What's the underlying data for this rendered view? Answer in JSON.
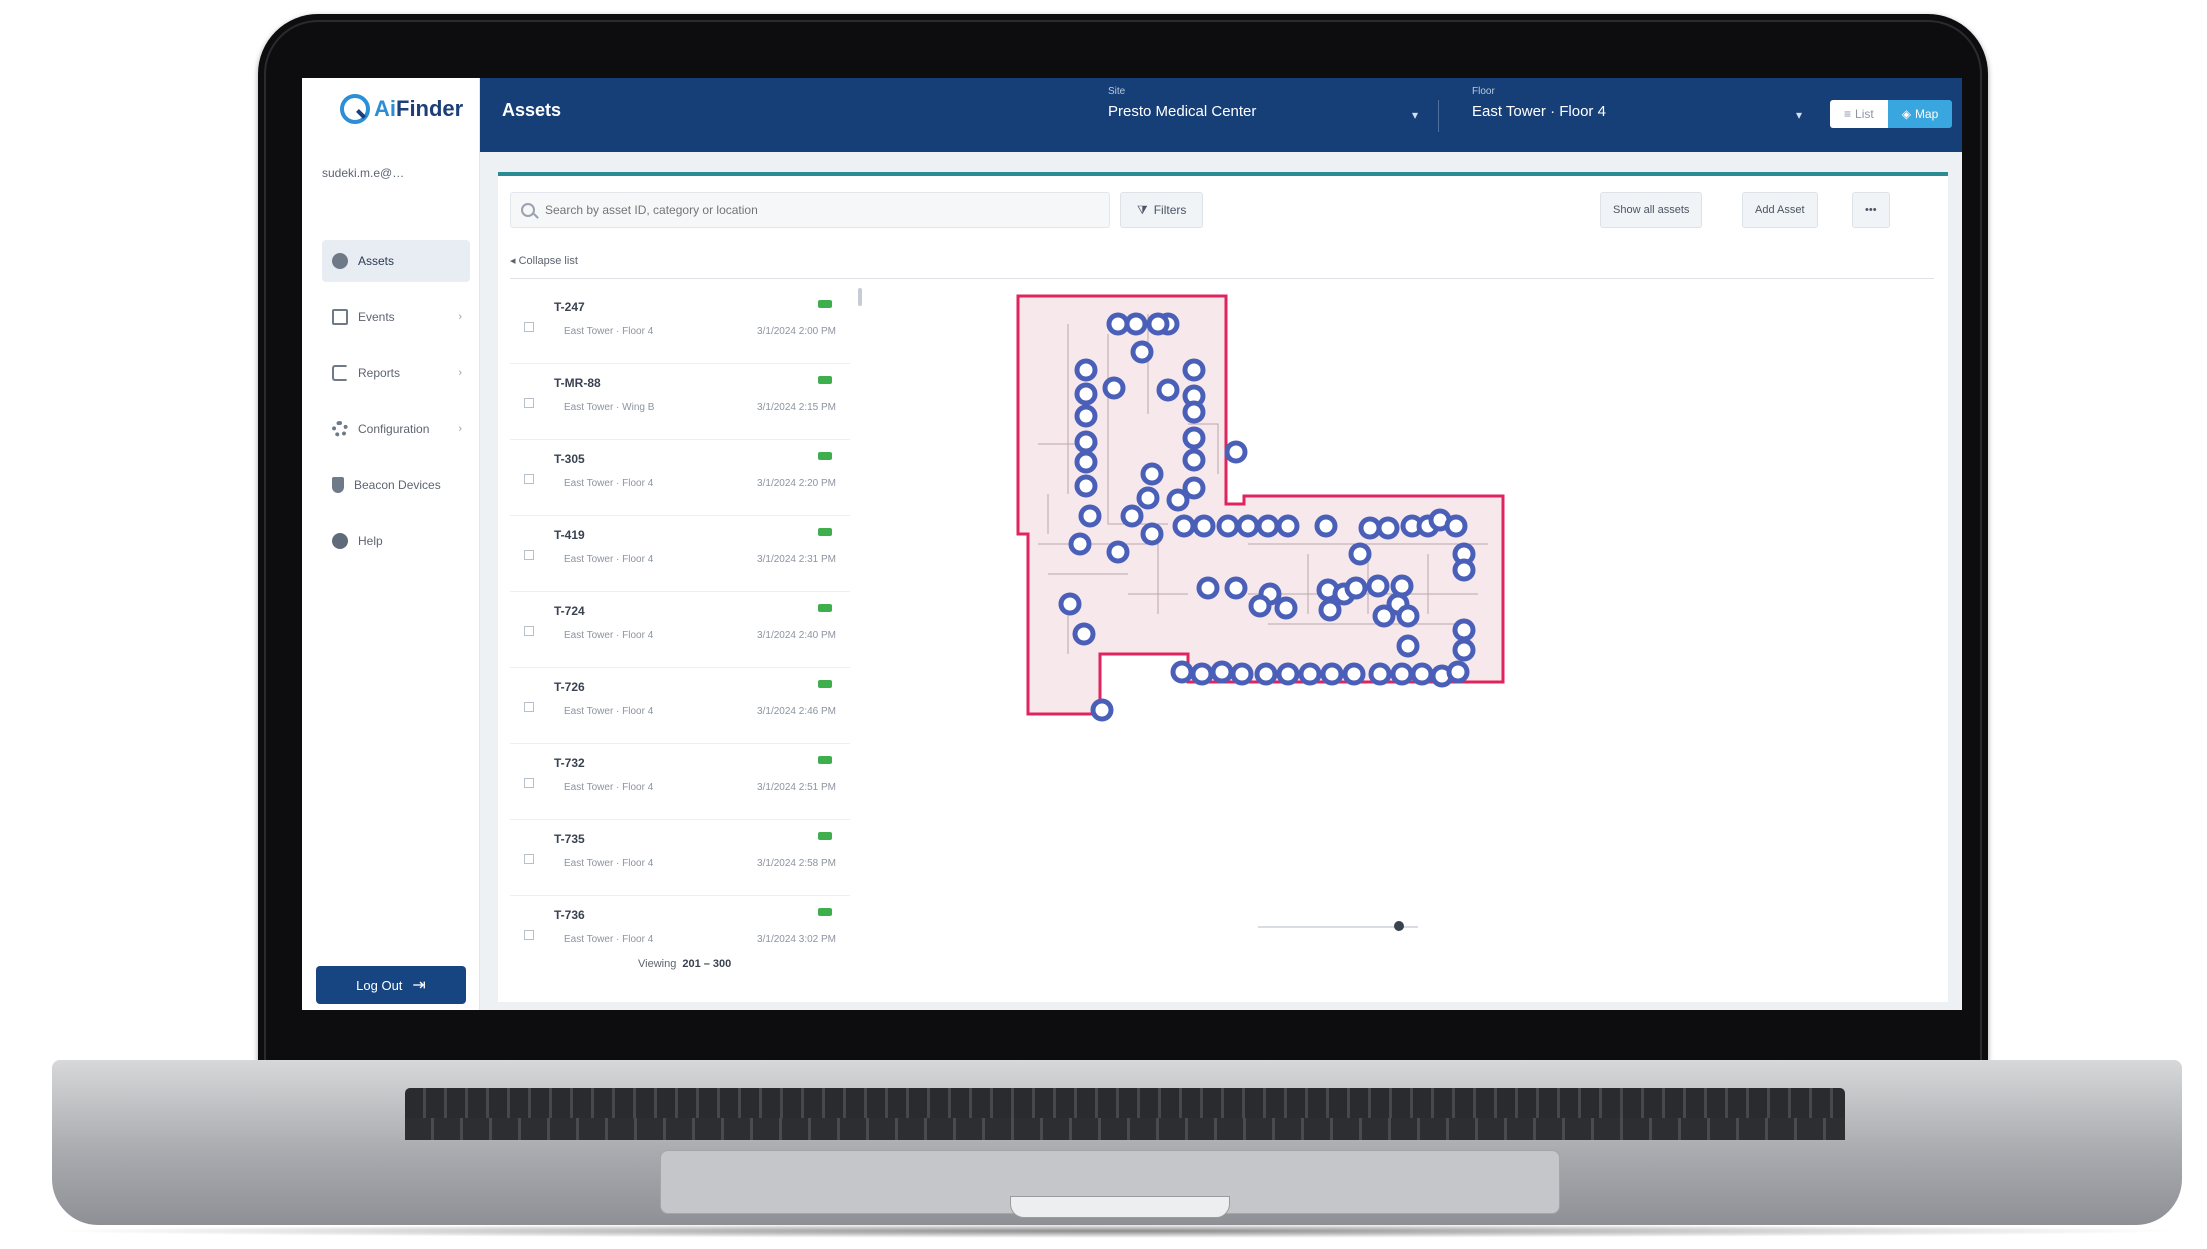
{
  "app": {
    "brand_part1": "Ai",
    "brand_part2": "Finder",
    "user_email": "sudeki.m.e@…",
    "user_role": "",
    "logout_label": "Log Out"
  },
  "sidebar": {
    "items": [
      {
        "label": "Assets",
        "icon": "home-icon",
        "active": true
      },
      {
        "label": "Events",
        "icon": "document-icon",
        "active": false
      },
      {
        "label": "Reports",
        "icon": "rotate-icon",
        "active": false
      },
      {
        "label": "Configuration",
        "icon": "gear-icon",
        "active": false
      },
      {
        "label": "Beacon Devices",
        "icon": "tag-icon",
        "active": false
      },
      {
        "label": "Help",
        "icon": "help-icon",
        "active": false
      }
    ]
  },
  "header": {
    "title": "Assets",
    "site_label": "Site",
    "site_value": "Presto Medical Center",
    "floor_label": "Floor",
    "floor_value": "East Tower · Floor 4",
    "toggle_off": "List",
    "toggle_on": "Map"
  },
  "toolbar": {
    "search_placeholder": "Search by asset ID, category or location",
    "filters_label": "Filters",
    "btn_1": "Show all assets",
    "btn_2": "Add Asset",
    "btn_3": "•••",
    "collapse_label": "◂ Collapse list"
  },
  "assets": [
    {
      "id": "T-247",
      "floor": "East Tower · Floor 4",
      "time": "3/1/2024 2:00 PM",
      "status_color": "#3fae4d"
    },
    {
      "id": "T-MR-88",
      "floor": "East Tower · Wing B",
      "time": "3/1/2024 2:15 PM",
      "status_color": "#3fae4d"
    },
    {
      "id": "T-305",
      "floor": "East Tower · Floor 4",
      "time": "3/1/2024 2:20 PM",
      "status_color": "#3fae4d"
    },
    {
      "id": "T-419",
      "floor": "East Tower · Floor 4",
      "time": "3/1/2024 2:31 PM",
      "status_color": "#3fae4d"
    },
    {
      "id": "T-724",
      "floor": "East Tower · Floor 4",
      "time": "3/1/2024 2:40 PM",
      "status_color": "#3fae4d"
    },
    {
      "id": "T-726",
      "floor": "East Tower · Floor 4",
      "time": "3/1/2024 2:46 PM",
      "status_color": "#3fae4d"
    },
    {
      "id": "T-732",
      "floor": "East Tower · Floor 4",
      "time": "3/1/2024 2:51 PM",
      "status_color": "#3fae4d"
    },
    {
      "id": "T-735",
      "floor": "East Tower · Floor 4",
      "time": "3/1/2024 2:58 PM",
      "status_color": "#3fae4d"
    },
    {
      "id": "T-736",
      "floor": "East Tower · Floor 4",
      "time": "3/1/2024 3:02 PM",
      "status_color": "#3fae4d"
    }
  ],
  "pagination": {
    "prefix": "Viewing",
    "range": "201 – 300"
  },
  "map": {
    "floor_outline_color": "#e0245e",
    "marker_color": "#4a5fb8",
    "marker_count": 78
  },
  "colors": {
    "brand_navy": "#163f78",
    "accent_blue": "#3aa6e0",
    "status_green": "#3fae4d"
  }
}
